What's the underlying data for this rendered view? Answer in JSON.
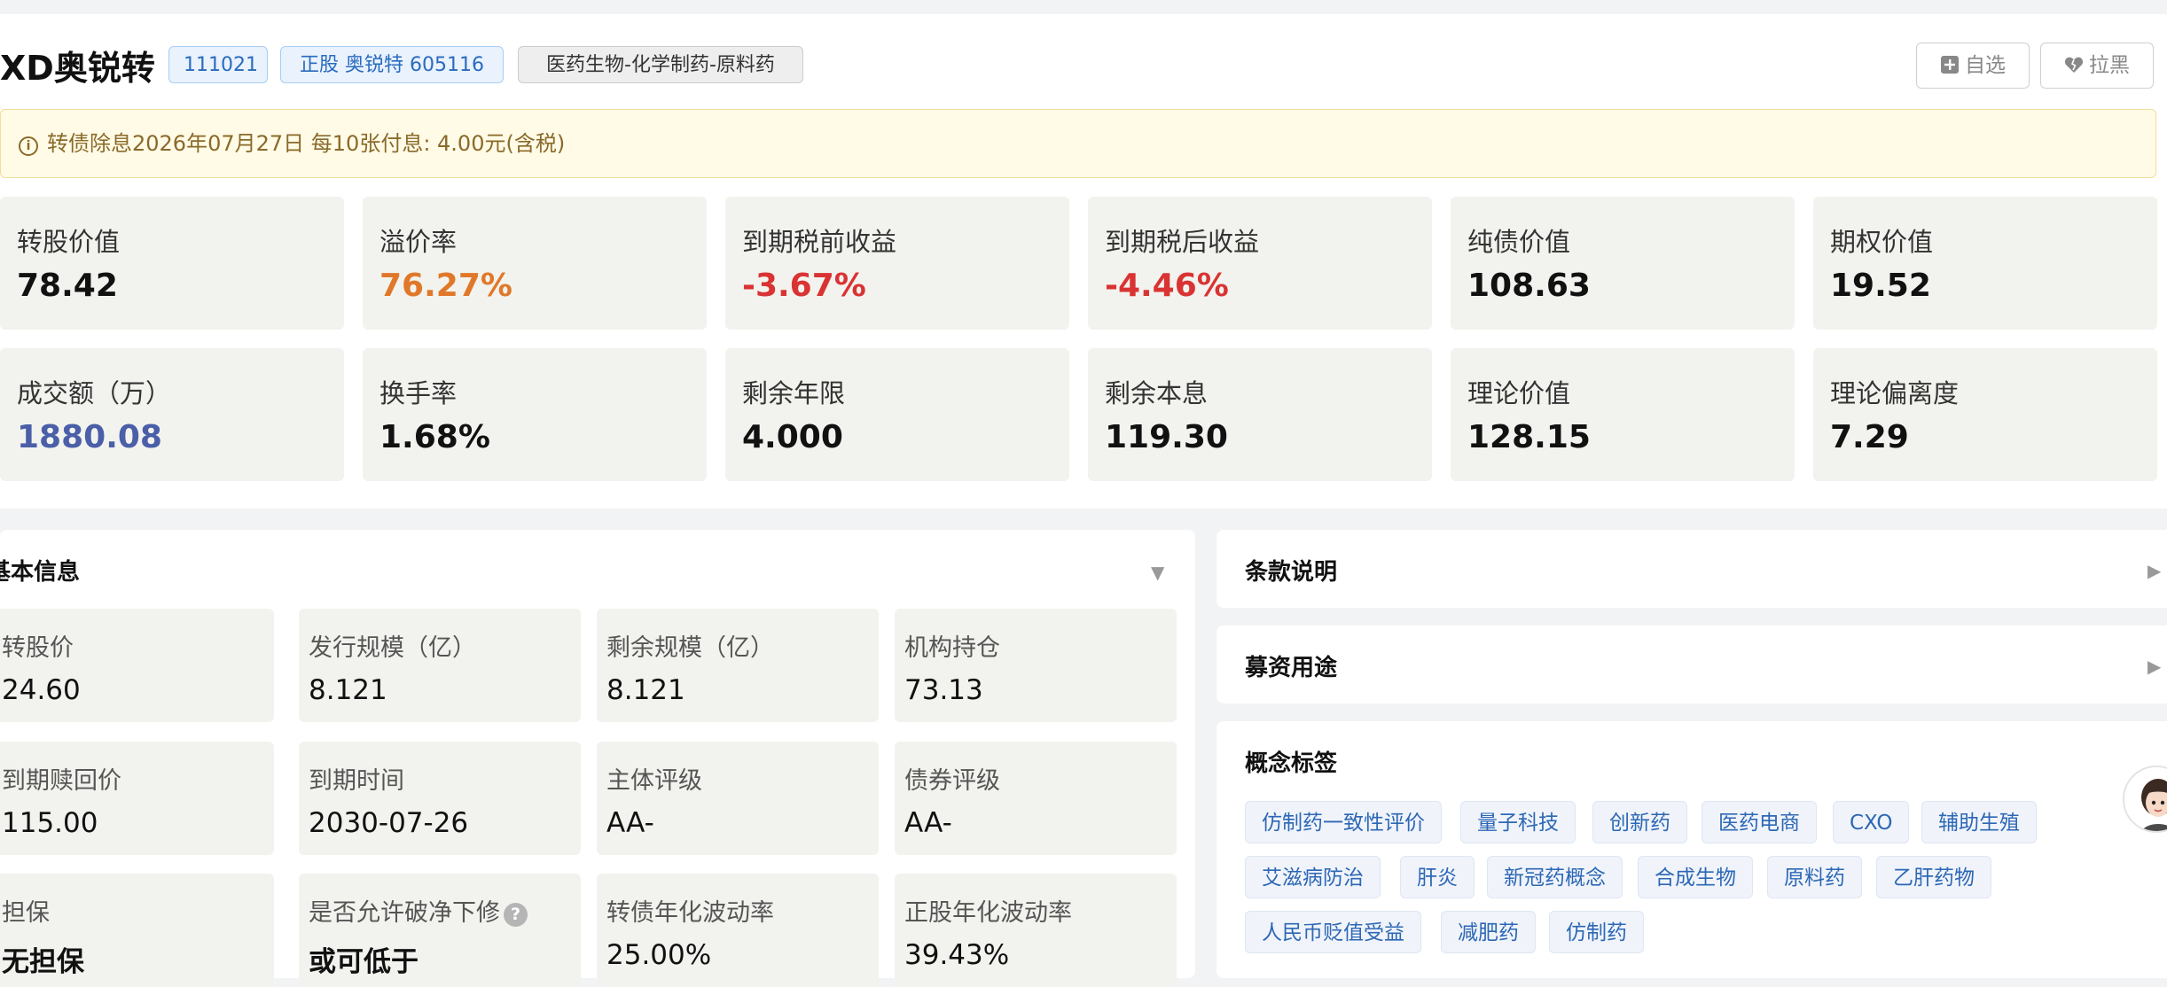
{
  "header": {
    "title": "XD奥锐转",
    "code_tag": "111021",
    "stock_tag": "正股 奥锐特 605116",
    "industry_tag": "医药生物-化学制药-原料药",
    "watch_button": "自选",
    "block_button": "拉黑"
  },
  "notice": {
    "text": "转债除息2026年07月27日 每10张付息: 4.00元(含税)"
  },
  "metrics": [
    {
      "label": "转股价值",
      "value": "78.42"
    },
    {
      "label": "溢价率",
      "value": "76.27%"
    },
    {
      "label": "到期税前收益",
      "value": "-3.67%"
    },
    {
      "label": "到期税后收益",
      "value": "-4.46%"
    },
    {
      "label": "纯债价值",
      "value": "108.63"
    },
    {
      "label": "期权价值",
      "value": "19.52"
    },
    {
      "label": "成交额（万）",
      "value": "1880.08"
    },
    {
      "label": "换手率",
      "value": "1.68%"
    },
    {
      "label": "剩余年限",
      "value": "4.000"
    },
    {
      "label": "剩余本息",
      "value": "119.30"
    },
    {
      "label": "理论价值",
      "value": "128.15"
    },
    {
      "label": "理论偏离度",
      "value": "7.29"
    }
  ],
  "metric_colors": {
    "premium": "#e0782a",
    "negative": "#d93333",
    "volume": "#4a5fa8",
    "default": "#111111"
  },
  "basic_info": {
    "title": "基本信息",
    "items": [
      {
        "label": "转股价",
        "value": "24.60"
      },
      {
        "label": "发行规模（亿）",
        "value": "8.121"
      },
      {
        "label": "剩余规模（亿）",
        "value": "8.121"
      },
      {
        "label": "机构持仓",
        "value": "73.13"
      },
      {
        "label": "到期赎回价",
        "value": "115.00"
      },
      {
        "label": "到期时间",
        "value": "2030-07-26"
      },
      {
        "label": "主体评级",
        "value": "AA-"
      },
      {
        "label": "债券评级",
        "value": "AA-"
      },
      {
        "label": "担保",
        "value": "无担保"
      },
      {
        "label": "是否允许破净下修",
        "value": "或可低于"
      },
      {
        "label": "转债年化波动率",
        "value": "25.00%"
      },
      {
        "label": "正股年化波动率",
        "value": "39.43%"
      }
    ]
  },
  "terms": {
    "title": "条款说明"
  },
  "funds": {
    "title": "募资用途"
  },
  "concepts": {
    "title": "概念标签",
    "tags": [
      "仿制药一致性评价",
      "量子科技",
      "创新药",
      "医药电商",
      "CXO",
      "辅助生殖",
      "艾滋病防治",
      "肝炎",
      "新冠药概念",
      "合成生物",
      "原料药",
      "乙肝药物",
      "人民币贬值受益",
      "减肥药",
      "仿制药"
    ]
  }
}
